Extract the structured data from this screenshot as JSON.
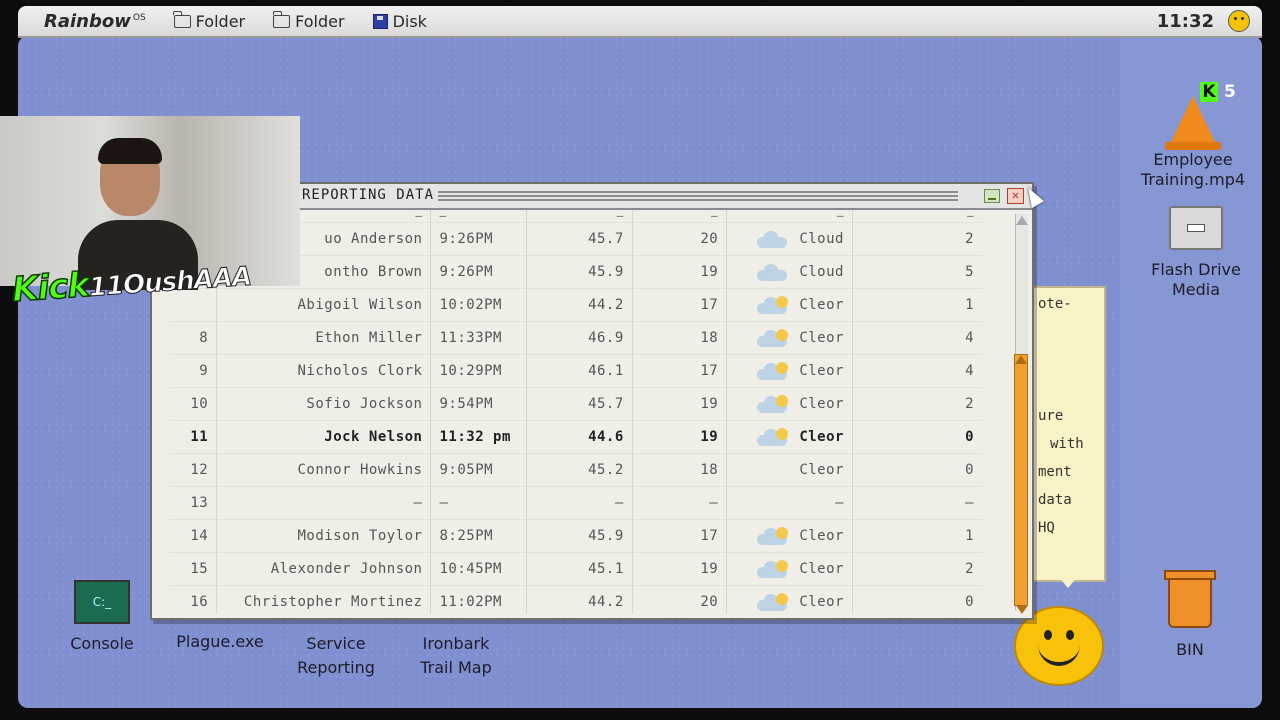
{
  "menubar": {
    "brand": "Rainbow",
    "brand_sup": "OS",
    "items": [
      {
        "label": "Folder"
      },
      {
        "label": "Folder"
      },
      {
        "label": "Disk"
      }
    ],
    "clock": "11:32"
  },
  "window": {
    "title": "REPORTING DATA",
    "rows": [
      {
        "num": "",
        "name": "–",
        "time": "–",
        "a": "–",
        "b": "–",
        "weather": "–",
        "icon": "none",
        "d": "–",
        "dash": true
      },
      {
        "num": "",
        "name": "uo Anderson",
        "time": "9:26PM",
        "a": "45.7",
        "b": "20",
        "weather": "Cloud",
        "icon": "cloud",
        "d": "2"
      },
      {
        "num": "",
        "name": "ontho Brown",
        "time": "9:26PM",
        "a": "45.9",
        "b": "19",
        "weather": "Cloud",
        "icon": "cloud",
        "d": "5"
      },
      {
        "num": "",
        "name": "Abigoil Wilson",
        "time": "10:02PM",
        "a": "44.2",
        "b": "17",
        "weather": "Cleor",
        "icon": "sun",
        "d": "1"
      },
      {
        "num": "8",
        "name": "Ethon Miller",
        "time": "11:33PM",
        "a": "46.9",
        "b": "18",
        "weather": "Cleor",
        "icon": "sun",
        "d": "4"
      },
      {
        "num": "9",
        "name": "Nicholos Clork",
        "time": "10:29PM",
        "a": "46.1",
        "b": "17",
        "weather": "Cleor",
        "icon": "sun",
        "d": "4"
      },
      {
        "num": "10",
        "name": "Sofio Jockson",
        "time": "9:54PM",
        "a": "45.7",
        "b": "19",
        "weather": "Cleor",
        "icon": "sun",
        "d": "2"
      },
      {
        "num": "11",
        "name": "Jock Nelson",
        "time": "11:32 pm",
        "a": "44.6",
        "b": "19",
        "weather": "Cleor",
        "icon": "sun",
        "d": "0",
        "bold": true
      },
      {
        "num": "12",
        "name": "Connor Howkins",
        "time": "9:05PM",
        "a": "45.2",
        "b": "18",
        "weather": "Cleor",
        "icon": "none",
        "d": "0"
      },
      {
        "num": "13",
        "name": "–",
        "time": "–",
        "a": "–",
        "b": "–",
        "weather": "–",
        "icon": "none",
        "d": "–"
      },
      {
        "num": "14",
        "name": "Modison Toylor",
        "time": "8:25PM",
        "a": "45.9",
        "b": "17",
        "weather": "Cleor",
        "icon": "sun",
        "d": "1"
      },
      {
        "num": "15",
        "name": "Alexonder Johnson",
        "time": "10:45PM",
        "a": "45.1",
        "b": "19",
        "weather": "Cleor",
        "icon": "sun",
        "d": "2"
      },
      {
        "num": "16",
        "name": "Christopher Mortinez",
        "time": "11:02PM",
        "a": "44.2",
        "b": "20",
        "weather": "Cleor",
        "icon": "sun",
        "d": "0"
      }
    ]
  },
  "note": {
    "lines": [
      "ote-",
      "ure",
      "with",
      "ment",
      "data",
      "HQ"
    ]
  },
  "desktop_icons": {
    "video": {
      "line1": "Employee",
      "line2": "Training.mp4"
    },
    "badge_count": "5",
    "badge_letter": "K",
    "drive": {
      "line1": "Flash Drive",
      "line2": "Media"
    },
    "console": {
      "label": "Console",
      "glyph": "C:_"
    },
    "plague": {
      "label": "Plague.exe"
    },
    "service": {
      "line1": "Service",
      "line2": "Reporting"
    },
    "ironbark": {
      "line1": "Ironbark",
      "line2": "Trail Map"
    },
    "bin": {
      "label": "BIN"
    }
  },
  "overlay": {
    "logo_main": "Kick",
    "logo_tail": "11OushAAA"
  },
  "colors": {
    "desktop": "#7f8fcf",
    "window_bg": "#efefe8",
    "scroll_thumb": "#f0a132",
    "kick_green": "#53fc18"
  }
}
